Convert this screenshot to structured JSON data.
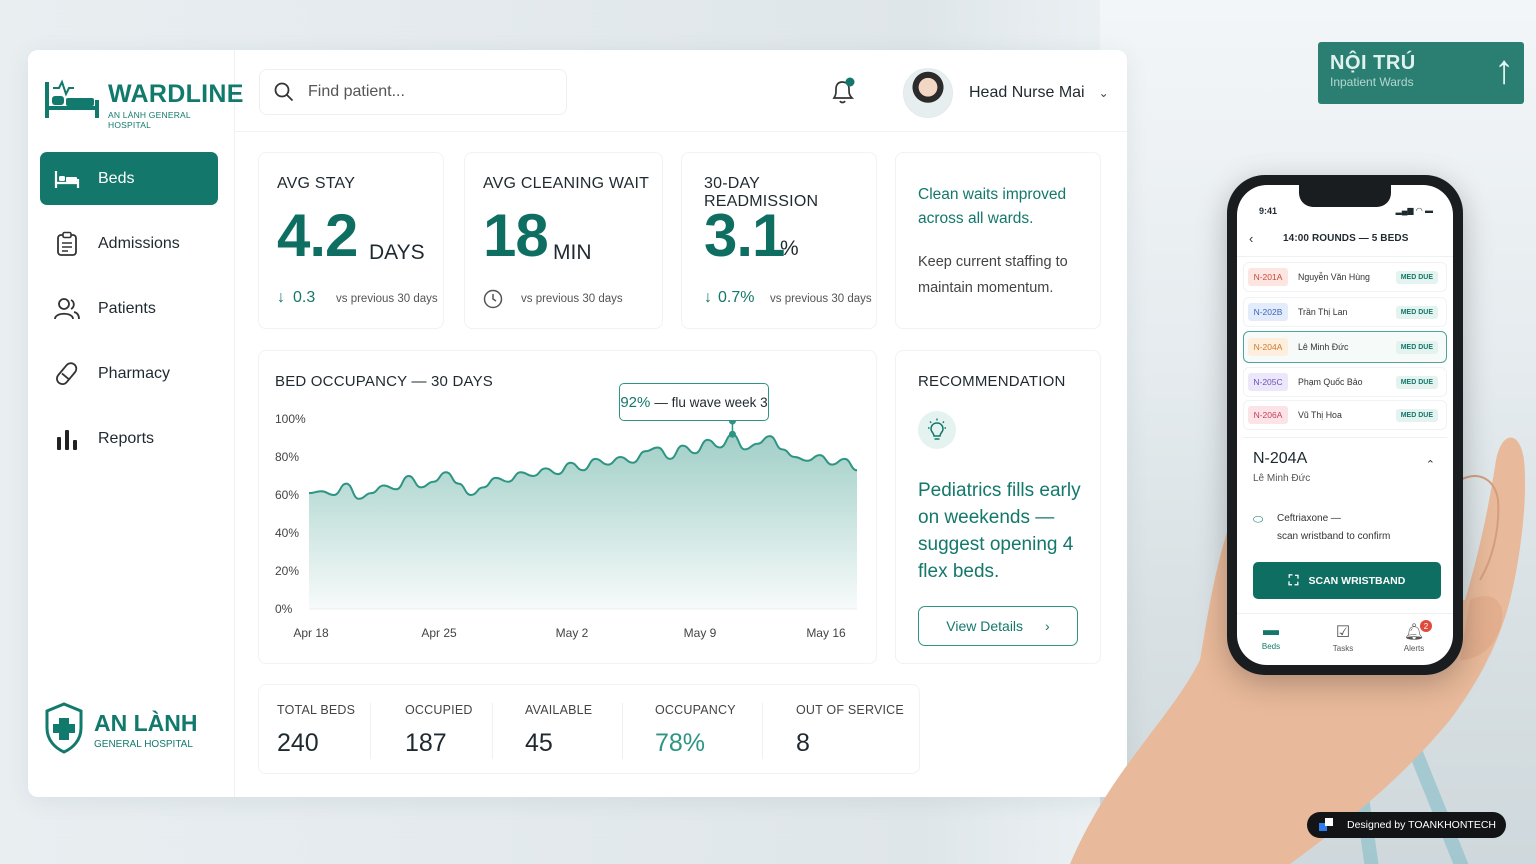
{
  "background": {
    "sign_title": "NỘI TRÚ",
    "sign_subtitle": "Inpatient Wards"
  },
  "brand": {
    "app_name": "WARDLINE",
    "hospital": "AN LÀNH GENERAL HOSPITAL",
    "footer_name": "AN LÀNH",
    "footer_sub": "GENERAL HOSPITAL",
    "accent": "#13786b"
  },
  "sidebar": {
    "items": [
      {
        "label": "Beds",
        "icon": "bed-icon",
        "active": true
      },
      {
        "label": "Admissions",
        "icon": "clipboard-icon",
        "active": false
      },
      {
        "label": "Patients",
        "icon": "users-icon",
        "active": false
      },
      {
        "label": "Pharmacy",
        "icon": "pill-icon",
        "active": false
      },
      {
        "label": "Reports",
        "icon": "bar-chart-icon",
        "active": false
      }
    ]
  },
  "topbar": {
    "search_placeholder": "Find patient...",
    "user_name": "Head Nurse Mai",
    "notification_dot": true
  },
  "kpis": [
    {
      "title": "AVG STAY",
      "value": "4.2",
      "unit": "DAYS",
      "delta": "0.3",
      "compare": "vs previous 30 days",
      "delta_icon": "arrow-down-icon"
    },
    {
      "title": "AVG CLEANING WAIT",
      "value": "18",
      "unit": "MIN",
      "delta": "",
      "compare": "vs previous 30 days",
      "delta_icon": "clock-icon"
    },
    {
      "title": "30-DAY READMISSION",
      "value": "3.1",
      "unit": "%",
      "delta": "0.7%",
      "compare": "vs previous 30 days",
      "delta_icon": "arrow-down-icon"
    }
  ],
  "note": {
    "headline": "Clean waits improved across all wards.",
    "body": "Keep current staffing to maintain momentum."
  },
  "chart_data": {
    "type": "area",
    "title": "BED OCCUPANCY — 30 DAYS",
    "xlabel": "",
    "ylabel": "",
    "x_ticks": [
      "Apr 18",
      "Apr 25",
      "May 2",
      "May 9",
      "May 16"
    ],
    "y_ticks": [
      "100%",
      "80%",
      "60%",
      "40%",
      "20%",
      "0%"
    ],
    "ylim": [
      0,
      100
    ],
    "grid": false,
    "series": [
      {
        "values": [
          61,
          62,
          60,
          66,
          58,
          61,
          65,
          63,
          70,
          64,
          67,
          72,
          66,
          60,
          64,
          69,
          67,
          72,
          70,
          74,
          71,
          77,
          73,
          79,
          76,
          80,
          77,
          83,
          85,
          79,
          86,
          82,
          89,
          85,
          92,
          84,
          87,
          91,
          84,
          80,
          78,
          81,
          76,
          79,
          73
        ]
      }
    ],
    "annotation": {
      "value": "92%",
      "text": "— flu wave week 3"
    }
  },
  "recommendation": {
    "title": "RECOMMENDATION",
    "text": "Pediatrics fills early on weekends — suggest opening 4 flex beds.",
    "button": "View Details"
  },
  "stats": [
    {
      "label": "TOTAL BEDS",
      "value": "240"
    },
    {
      "label": "OCCUPIED",
      "value": "187"
    },
    {
      "label": "AVAILABLE",
      "value": "45"
    },
    {
      "label": "OCCUPANCY",
      "value": "78%"
    },
    {
      "label": "OUT OF SERVICE",
      "value": "8"
    }
  ],
  "phone": {
    "time": "9:41",
    "title": "14:00 ROUNDS — 5 BEDS",
    "rows": [
      {
        "bed": "N-201A",
        "patient": "Nguyễn Văn Hùng",
        "tag": "MED DUE",
        "tone": "#fde6e2",
        "tone_text": "#c7493b"
      },
      {
        "bed": "N-202B",
        "patient": "Trần Thị Lan",
        "tag": "MED DUE",
        "tone": "#e3ecfb",
        "tone_text": "#3b66b8"
      },
      {
        "bed": "N-204A",
        "patient": "Lê Minh Đức",
        "tag": "MED DUE",
        "tone": "#fdeede",
        "tone_text": "#d07a2b",
        "selected": true
      },
      {
        "bed": "N-205C",
        "patient": "Phạm Quốc Bảo",
        "tag": "MED DUE",
        "tone": "#ece7fa",
        "tone_text": "#6b52b8"
      },
      {
        "bed": "N-206A",
        "patient": "Vũ Thị Hoa",
        "tag": "MED DUE",
        "tone": "#fce3e8",
        "tone_text": "#c2405b"
      }
    ],
    "detail": {
      "bed": "N-204A",
      "patient": "Lê Minh Đức",
      "drug": "Ceftriaxone —",
      "drug_note": "scan wristband to confirm"
    },
    "scan_button": "SCAN WRISTBAND",
    "tabs": [
      {
        "label": "Beds",
        "icon": "bed-icon"
      },
      {
        "label": "Tasks",
        "icon": "checklist-icon"
      },
      {
        "label": "Alerts",
        "icon": "bell-icon",
        "badge": "2"
      }
    ]
  },
  "credit": "Designed by TOANKHONTECH"
}
